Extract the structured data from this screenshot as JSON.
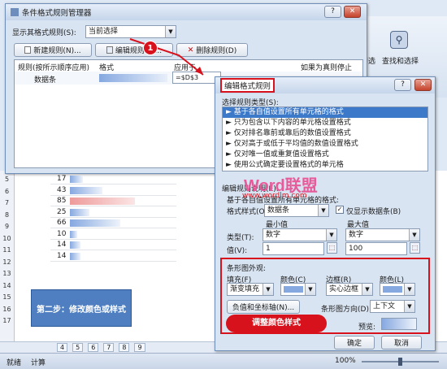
{
  "colors": {
    "accent_red": "#d8121c",
    "title_blue": "#1b5fb5",
    "bar": "#86a8e0",
    "bar_red": "#f0a3a3"
  },
  "manager": {
    "title": "条件格式规则管理器",
    "show_rules_label": "显示其格式规则(S):",
    "show_rules_value": "当前选择",
    "new_rule": "新建规则(N)...",
    "edit_rule": "编辑规则(E)...",
    "delete_rule": "删除规则(D)",
    "col_rule": "规则(按所示顺序应用)",
    "col_format": "格式",
    "col_applies": "应用于",
    "col_stop": "如果为真则停止",
    "row_rule": "数据条",
    "row_applies": "=$D$3"
  },
  "edit": {
    "title": "编辑格式规则",
    "select_type_label": "选择规则类型(S):",
    "rule_types": [
      "► 基于各自值设置所有单元格的格式",
      "► 只为包含以下内容的单元格设置格式",
      "► 仅对排名靠前或靠后的数值设置格式",
      "► 仅对高于或低于平均值的数值设置格式",
      "► 仅对唯一值或重复值设置格式",
      "► 使用公式确定要设置格式的单元格"
    ],
    "edit_desc_label": "编辑规则说明(E):",
    "based_on": "基于各自值设置所有单元格的格式:",
    "format_style_label": "格式样式(O):",
    "format_style_value": "数据条",
    "show_bar_only": "仅显示数据条(B)",
    "min_label": "最小值",
    "max_label": "最大值",
    "type_label": "类型(T):",
    "type_min": "数字",
    "type_max": "数字",
    "value_label": "值(V):",
    "value_min": "1",
    "value_max": "100",
    "appearance_label": "条形图外观:",
    "fill_label": "填充(F)",
    "color_label": "颜色(C)",
    "border_label": "边框(R)",
    "border_color_label": "颜色(L)",
    "fill_value": "渐变填充",
    "border_value": "实心边框",
    "neg_axis_btn": "负值和坐标轴(N)...",
    "bar_dir_label": "条形图方向(D):",
    "bar_dir_value": "上下文",
    "preview_label": "预览:",
    "ok": "确定",
    "cancel": "取消"
  },
  "annotations": {
    "step1": "1",
    "step2": "第二步：修改颜色或样式",
    "adjust": "调整颜色样式"
  },
  "watermark": {
    "logo": "Word联盟",
    "url": "www.wordlm.com"
  },
  "ribbon": {
    "filter": "筛选",
    "find_select": "查找和选择"
  },
  "sheet": {
    "rows": [
      {
        "n": "",
        "v": "17"
      },
      {
        "n": "",
        "v": "43"
      },
      {
        "n": "",
        "v": "85"
      },
      {
        "n": "",
        "v": "25"
      },
      {
        "n": "",
        "v": "66"
      },
      {
        "n": "",
        "v": "10"
      },
      {
        "n": "",
        "v": "14"
      },
      {
        "n": "",
        "v": "14"
      }
    ],
    "rownums": [
      "5",
      "6",
      "7",
      "8",
      "9",
      "10",
      "11",
      "12",
      "13",
      "14",
      "15",
      "16",
      "17"
    ],
    "tabs": [
      "4",
      "5",
      "6",
      "7",
      "8",
      "9"
    ],
    "status_ready": "就绪",
    "status_calc": "计算",
    "zoom": "100%"
  }
}
